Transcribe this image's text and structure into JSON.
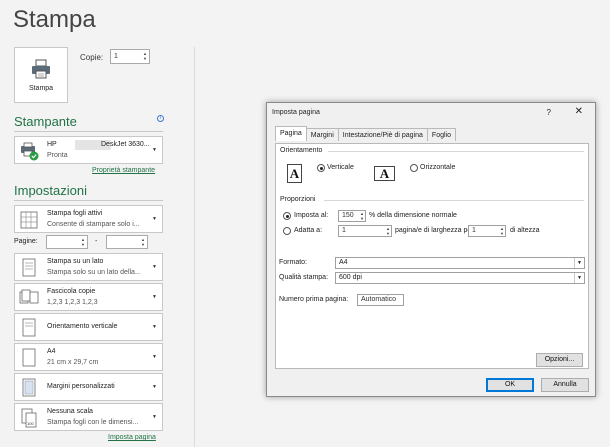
{
  "page_title": "Stampa",
  "print_button_label": "Stampa",
  "copies": {
    "label": "Copie:",
    "value": "1"
  },
  "printer": {
    "heading": "Stampante",
    "name_prefix": "HP",
    "name_suffix": "DeskJet 3630...",
    "status": "Pronta",
    "properties_link": "Proprietà stampante"
  },
  "settings": {
    "heading": "Impostazioni",
    "what": {
      "line1": "Stampa fogli attivi",
      "line2": "Consente di stampare solo i..."
    },
    "pages": {
      "label": "Pagine:",
      "separator": "-"
    },
    "sides": {
      "line1": "Stampa su un lato",
      "line2": "Stampa solo su un lato della..."
    },
    "collate": {
      "line1": "Fascicola copie",
      "line2": "1,2,3   1,2,3   1,2,3"
    },
    "orientation": {
      "line1": "Orientamento verticale"
    },
    "paper": {
      "line1": "A4",
      "line2": "21 cm x 29,7 cm"
    },
    "margins": {
      "line1": "Margini personalizzati"
    },
    "scaling": {
      "line1": "Nessuna scala",
      "line2": "Stampa fogli con le dimensi..."
    },
    "page_setup_link": "Imposta pagina"
  },
  "dialog": {
    "title": "Imposta pagina",
    "help": "?",
    "close": "✕",
    "tabs": [
      "Pagina",
      "Margini",
      "Intestazione/Piè di pagina",
      "Foglio"
    ],
    "orientation_group": "Orientamento",
    "portrait_label": "Verticale",
    "landscape_label": "Orizzontale",
    "orientation_icon_letter": "A",
    "proportions_group": "Proporzioni",
    "adjust_to_label": "Imposta al:",
    "adjust_value": "150",
    "adjust_suffix": "% della dimensione normale",
    "fit_to_label": "Adatta a:",
    "fit_width_value": "1",
    "fit_width_suffix": "pagina/e di larghezza per",
    "fit_height_value": "1",
    "fit_height_suffix": "di altezza",
    "paper_size_label": "Formato:",
    "paper_size_value": "A4",
    "print_quality_label": "Qualità stampa:",
    "print_quality_value": "600 dpi",
    "first_page_label": "Numero prima pagina:",
    "first_page_value": "Automatico",
    "options_button": "Opzioni...",
    "ok_button": "OK",
    "cancel_button": "Annulla"
  }
}
